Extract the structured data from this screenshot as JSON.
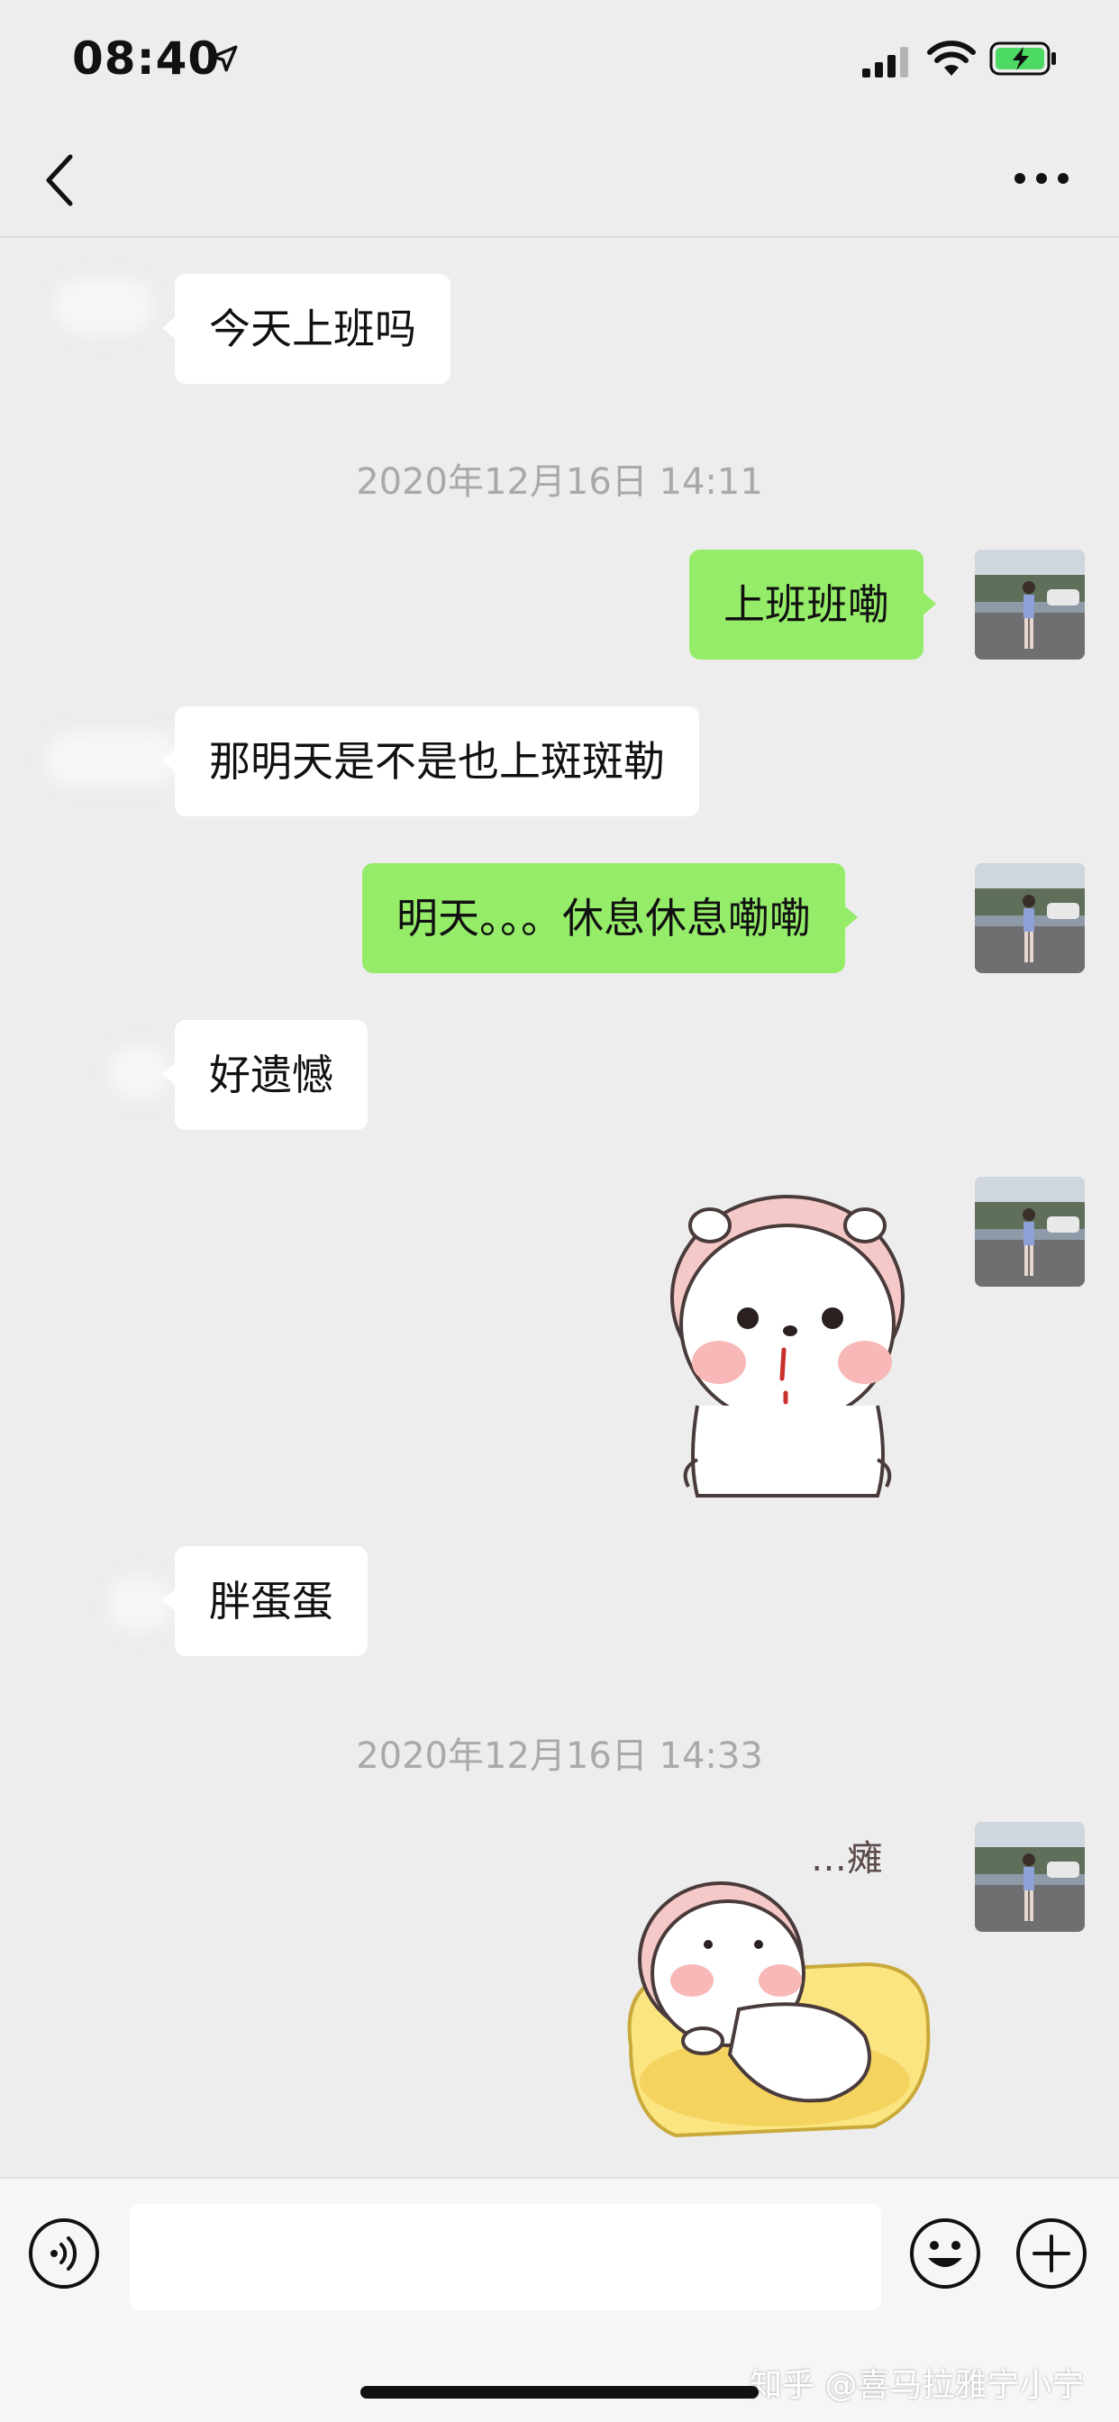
{
  "status_bar": {
    "time": "08:40",
    "icons": [
      "location-arrow-icon",
      "cellular-signal-icon",
      "wifi-icon",
      "battery-charging-icon"
    ],
    "battery_color": "#4cd964"
  },
  "nav_bar": {
    "back_icon": "chevron-left-icon",
    "more_icon": "more-dots-icon"
  },
  "messages": [
    {
      "side": "left",
      "type": "text",
      "text": "今天上班吗"
    },
    {
      "type": "timestamp",
      "text": "2020年12月16日 14:11"
    },
    {
      "side": "right",
      "type": "text",
      "text": "上班班嘞"
    },
    {
      "side": "left",
      "type": "text",
      "text": "那明天是不是也上斑斑勒"
    },
    {
      "side": "right",
      "type": "text",
      "text": "明天。。。休息休息嘞嘞"
    },
    {
      "side": "left",
      "type": "text",
      "text": "好遗憾"
    },
    {
      "side": "right",
      "type": "sticker",
      "sticker": "bear-drooling-sticker"
    },
    {
      "side": "left",
      "type": "text",
      "text": "胖蛋蛋"
    },
    {
      "type": "timestamp",
      "text": "2020年12月16日 14:33"
    },
    {
      "side": "right",
      "type": "sticker",
      "sticker": "bear-lying-sticker",
      "caption": "…瘫"
    }
  ],
  "input_bar": {
    "voice_icon": "voice-icon",
    "text_value": "",
    "emoji_icon": "emoji-icon",
    "plus_icon": "plus-icon"
  },
  "watermark": "知乎 @喜马拉雅宁小宁",
  "colors": {
    "background": "#ededed",
    "bubble_left": "#ffffff",
    "bubble_right": "#95ec69",
    "timestamp": "#a9a9a9"
  }
}
